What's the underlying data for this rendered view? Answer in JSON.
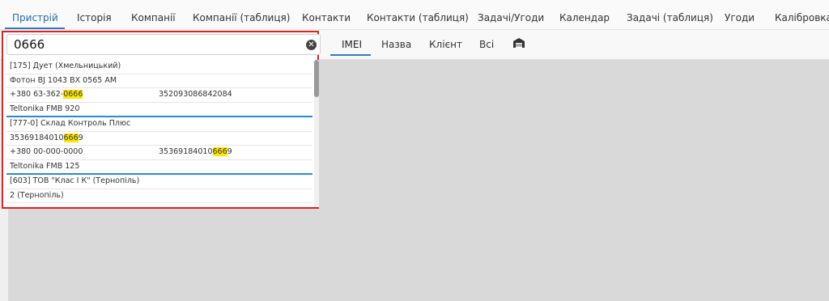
{
  "top_tabs": [
    "Пристрій",
    "Історія",
    "Компанії",
    "Компанії (таблиця)",
    "Контакти",
    "Контакти (таблиця)",
    "Задачі/Угоди",
    "Календар",
    "Задачі (таблиця)",
    "Угоди",
    "Калібровка"
  ],
  "sub_tabs": [
    "IMEI",
    "Назва",
    "Клієнт",
    "Всі"
  ],
  "search": {
    "value": "0666"
  },
  "results": [
    {
      "text": "[175] Дует (Хмельницький)"
    },
    {
      "text": "Фотон BJ 1043 BX 0565 AM"
    },
    {
      "pre": "+380 63-362-",
      "hl": "0666",
      "post": "",
      "col2": "352093086842084"
    },
    {
      "text": "Teltonika FMB 920",
      "sep": true
    },
    {
      "text": "[777-0] Склад Контроль Плюс"
    },
    {
      "pre": "35369184010",
      "hl": "666",
      "post": "9"
    },
    {
      "text": "+380 00-000-0000",
      "col2pre": "35369184010",
      "col2hl": "666",
      "col2post": "9"
    },
    {
      "text": "Teltonika FMB 125",
      "sep": true
    },
    {
      "text": "[603] ТОВ \"Клас І К\" (Тернопіль)"
    },
    {
      "text": "2 (Тернопіль)"
    }
  ]
}
